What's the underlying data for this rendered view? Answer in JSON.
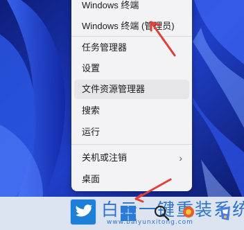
{
  "context_menu": {
    "items": [
      {
        "label": "Windows 终端"
      },
      {
        "label": "Windows 终端 (管理员)"
      },
      {
        "label": "任务管理器"
      },
      {
        "label": "设置"
      },
      {
        "label": "文件资源管理器"
      },
      {
        "label": "搜索"
      },
      {
        "label": "运行"
      },
      {
        "label": "关机或注销"
      },
      {
        "label": "桌面"
      }
    ],
    "submenu_chevron": "›"
  },
  "watermark": {
    "title": "白云一键重装系统",
    "url": "www.baiyunxitong.com"
  },
  "annotation_color": "#e0403a",
  "taskbar": {
    "icons": [
      "windows-start-icon",
      "search-icon",
      "app-icon",
      "colorful-app-icon"
    ]
  }
}
